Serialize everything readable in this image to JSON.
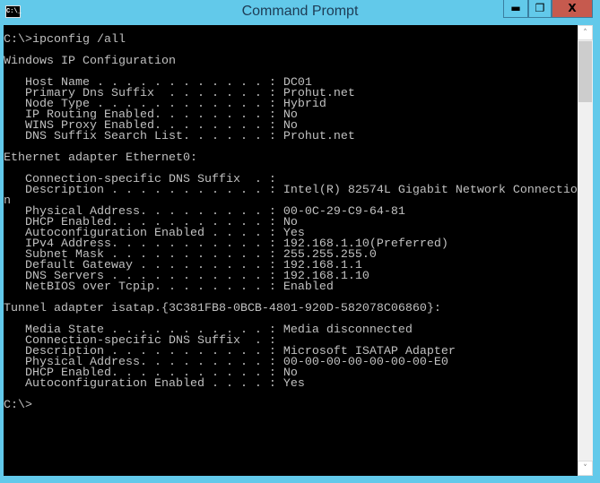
{
  "window": {
    "title": "Command Prompt",
    "icon_label": "C:\\_",
    "buttons": {
      "minimize": "▬",
      "maximize": "❐",
      "close": "X"
    }
  },
  "scrollbar": {
    "up": "˄",
    "down": "˅",
    "position_fraction": 0.0
  },
  "console": {
    "lines": [
      "C:\\>ipconfig /all",
      "",
      "Windows IP Configuration",
      "",
      "   Host Name . . . . . . . . . . . . : DC01",
      "   Primary Dns Suffix  . . . . . . . : Prohut.net",
      "   Node Type . . . . . . . . . . . . : Hybrid",
      "   IP Routing Enabled. . . . . . . . : No",
      "   WINS Proxy Enabled. . . . . . . . : No",
      "   DNS Suffix Search List. . . . . . : Prohut.net",
      "",
      "Ethernet adapter Ethernet0:",
      "",
      "   Connection-specific DNS Suffix  . :",
      "   Description . . . . . . . . . . . : Intel(R) 82574L Gigabit Network Connectio",
      "n",
      "   Physical Address. . . . . . . . . : 00-0C-29-C9-64-81",
      "   DHCP Enabled. . . . . . . . . . . : No",
      "   Autoconfiguration Enabled . . . . : Yes",
      "   IPv4 Address. . . . . . . . . . . : 192.168.1.10(Preferred)",
      "   Subnet Mask . . . . . . . . . . . : 255.255.255.0",
      "   Default Gateway . . . . . . . . . : 192.168.1.1",
      "   DNS Servers . . . . . . . . . . . : 192.168.1.10",
      "   NetBIOS over Tcpip. . . . . . . . : Enabled",
      "",
      "Tunnel adapter isatap.{3C381FB8-0BCB-4801-920D-582078C06860}:",
      "",
      "   Media State . . . . . . . . . . . : Media disconnected",
      "   Connection-specific DNS Suffix  . :",
      "   Description . . . . . . . . . . . : Microsoft ISATAP Adapter",
      "   Physical Address. . . . . . . . . : 00-00-00-00-00-00-00-E0",
      "   DHCP Enabled. . . . . . . . . . . : No",
      "   Autoconfiguration Enabled . . . . : Yes",
      "",
      "C:\\>"
    ]
  }
}
